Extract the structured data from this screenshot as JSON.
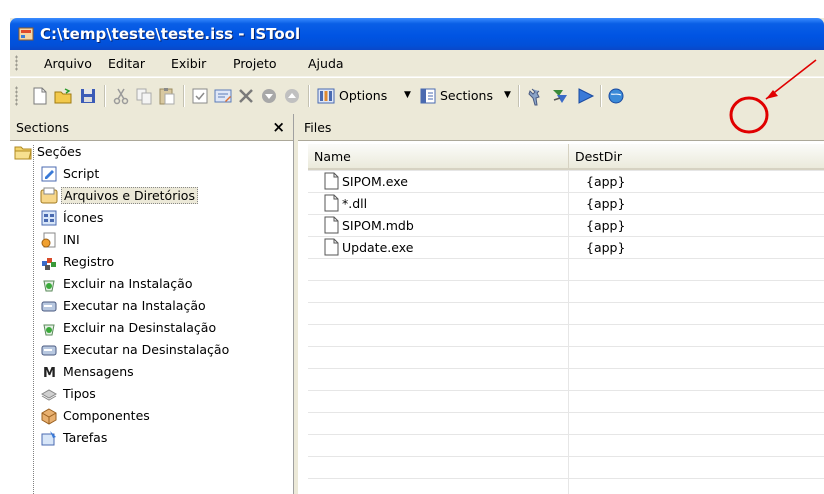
{
  "window": {
    "title": "C:\\temp\\teste\\teste.iss - ISTool"
  },
  "menu": [
    "Arquivo",
    "Editar",
    "Exibir",
    "Projeto",
    "Ajuda"
  ],
  "toolbar": {
    "options_label": "Options",
    "sections_label": "Sections"
  },
  "sections_pane": {
    "header": "Sections",
    "close_label": "×",
    "root": "Seções",
    "items": [
      {
        "label": "Script",
        "icon": "script-icon"
      },
      {
        "label": "Arquivos e Diretórios",
        "icon": "files-dirs-icon"
      },
      {
        "label": "Ícones",
        "icon": "icons-icon"
      },
      {
        "label": "INI",
        "icon": "ini-icon"
      },
      {
        "label": "Registro",
        "icon": "registry-icon"
      },
      {
        "label": "Excluir na Instalação",
        "icon": "delete-install-icon"
      },
      {
        "label": "Executar na Instalação",
        "icon": "run-install-icon"
      },
      {
        "label": "Excluir na Desinstalação",
        "icon": "delete-uninstall-icon"
      },
      {
        "label": "Executar na Desinstalação",
        "icon": "run-uninstall-icon"
      },
      {
        "label": "Mensagens",
        "icon": "messages-icon"
      },
      {
        "label": "Tipos",
        "icon": "types-icon"
      },
      {
        "label": "Componentes",
        "icon": "components-icon"
      },
      {
        "label": "Tarefas",
        "icon": "tasks-icon"
      }
    ]
  },
  "files_pane": {
    "header": "Files",
    "columns": [
      "Name",
      "DestDir"
    ],
    "rows": [
      {
        "name": "SIPOM.exe",
        "dest": "{app}"
      },
      {
        "name": "*.dll",
        "dest": "{app}"
      },
      {
        "name": "SIPOM.mdb",
        "dest": "{app}"
      },
      {
        "name": "Update.exe",
        "dest": "{app}"
      }
    ]
  },
  "colors": {
    "title_bar": "#0054e3",
    "annotation": "#e00000"
  }
}
